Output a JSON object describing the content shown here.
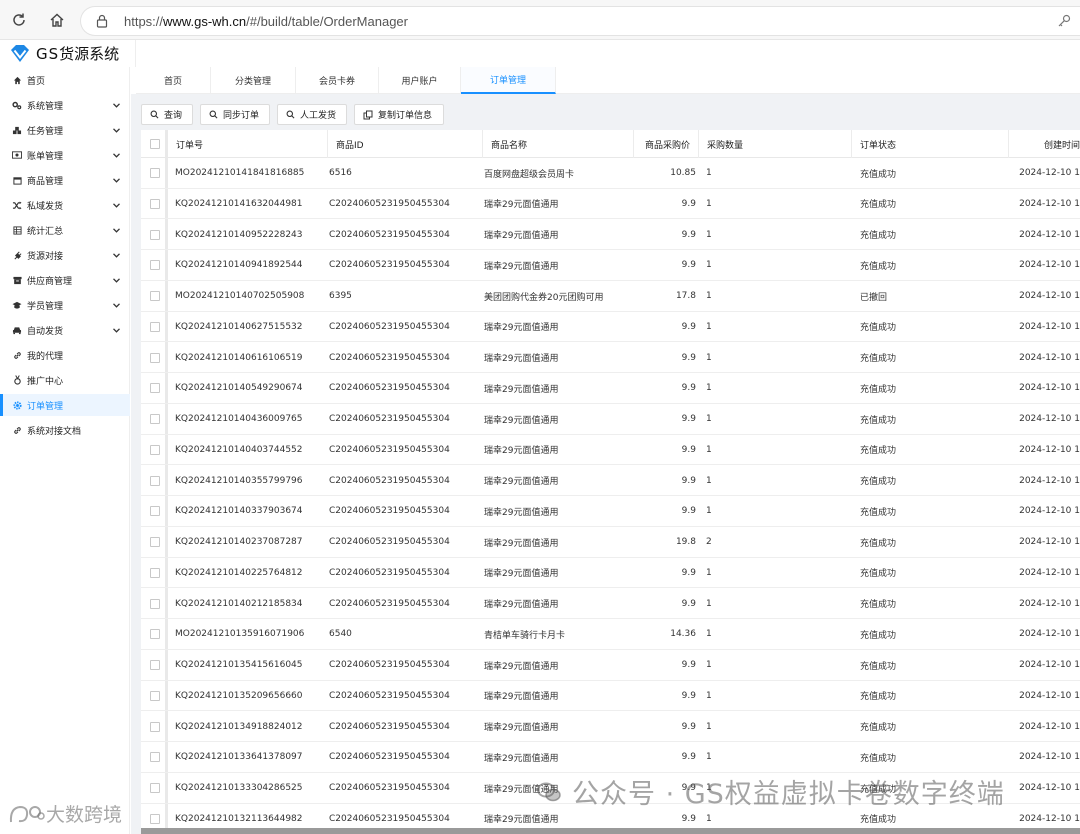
{
  "browser": {
    "url_prefix": "https://",
    "url_host": "www.gs-wh.cn",
    "url_path": "/#/build/table/OrderManager"
  },
  "app": {
    "logo_gs": "GS",
    "logo_name": "货源系统"
  },
  "sidebar": {
    "items": [
      {
        "label": "首页",
        "icon": "home-icon",
        "has_chevron": false
      },
      {
        "label": "系统管理",
        "icon": "gears-icon",
        "has_chevron": true
      },
      {
        "label": "任务管理",
        "icon": "cubes-icon",
        "has_chevron": true
      },
      {
        "label": "账单管理",
        "icon": "money-icon",
        "has_chevron": true
      },
      {
        "label": "商品管理",
        "icon": "calendar-icon",
        "has_chevron": true
      },
      {
        "label": "私域发货",
        "icon": "random-icon",
        "has_chevron": true
      },
      {
        "label": "统计汇总",
        "icon": "table-icon",
        "has_chevron": true
      },
      {
        "label": "货源对接",
        "icon": "plug-icon",
        "has_chevron": true
      },
      {
        "label": "供应商管理",
        "icon": "archive-icon",
        "has_chevron": true
      },
      {
        "label": "学员管理",
        "icon": "graduation-cap-icon",
        "has_chevron": true
      },
      {
        "label": "自动发货",
        "icon": "car-icon",
        "has_chevron": true
      },
      {
        "label": "我的代理",
        "icon": "link-icon",
        "has_chevron": false
      },
      {
        "label": "推广中心",
        "icon": "medal-icon",
        "has_chevron": false
      },
      {
        "label": "订单管理",
        "icon": "gear-icon",
        "has_chevron": false,
        "active": true
      },
      {
        "label": "系统对接文档",
        "icon": "link-icon",
        "has_chevron": false
      }
    ]
  },
  "tabs": [
    {
      "label": "首页"
    },
    {
      "label": "分类管理"
    },
    {
      "label": "会员卡券"
    },
    {
      "label": "用户账户"
    },
    {
      "label": "订单管理",
      "active": true
    }
  ],
  "toolbar": {
    "search": "查询",
    "sync": "同步订单",
    "manual": "人工发货",
    "copy": "复制订单信息"
  },
  "table": {
    "headers": {
      "order_no": "订单号",
      "product_id": "商品ID",
      "product_name": "商品名称",
      "price": "商品采购价",
      "qty": "采购数量",
      "status": "订单状态",
      "created": "创建时间"
    },
    "rows": [
      [
        "MO20241210141841816885",
        "6516",
        "百度网盘超级会员周卡",
        "10.85",
        "1",
        "充值成功",
        "2024-12-10 1"
      ],
      [
        "KQ20241210141632044981",
        "C20240605231950455304",
        "瑞幸29元面值通用",
        "9.9",
        "1",
        "充值成功",
        "2024-12-10 1"
      ],
      [
        "KQ20241210140952228243",
        "C20240605231950455304",
        "瑞幸29元面值通用",
        "9.9",
        "1",
        "充值成功",
        "2024-12-10 1"
      ],
      [
        "KQ20241210140941892544",
        "C20240605231950455304",
        "瑞幸29元面值通用",
        "9.9",
        "1",
        "充值成功",
        "2024-12-10 1"
      ],
      [
        "MO20241210140702505908",
        "6395",
        "美团团购代金券20元团购可用",
        "17.8",
        "1",
        "已撤回",
        "2024-12-10 1"
      ],
      [
        "KQ20241210140627515532",
        "C20240605231950455304",
        "瑞幸29元面值通用",
        "9.9",
        "1",
        "充值成功",
        "2024-12-10 1"
      ],
      [
        "KQ20241210140616106519",
        "C20240605231950455304",
        "瑞幸29元面值通用",
        "9.9",
        "1",
        "充值成功",
        "2024-12-10 1"
      ],
      [
        "KQ20241210140549290674",
        "C20240605231950455304",
        "瑞幸29元面值通用",
        "9.9",
        "1",
        "充值成功",
        "2024-12-10 1"
      ],
      [
        "KQ20241210140436009765",
        "C20240605231950455304",
        "瑞幸29元面值通用",
        "9.9",
        "1",
        "充值成功",
        "2024-12-10 1"
      ],
      [
        "KQ20241210140403744552",
        "C20240605231950455304",
        "瑞幸29元面值通用",
        "9.9",
        "1",
        "充值成功",
        "2024-12-10 1"
      ],
      [
        "KQ20241210140355799796",
        "C20240605231950455304",
        "瑞幸29元面值通用",
        "9.9",
        "1",
        "充值成功",
        "2024-12-10 1"
      ],
      [
        "KQ20241210140337903674",
        "C20240605231950455304",
        "瑞幸29元面值通用",
        "9.9",
        "1",
        "充值成功",
        "2024-12-10 1"
      ],
      [
        "KQ20241210140237087287",
        "C20240605231950455304",
        "瑞幸29元面值通用",
        "19.8",
        "2",
        "充值成功",
        "2024-12-10 1"
      ],
      [
        "KQ20241210140225764812",
        "C20240605231950455304",
        "瑞幸29元面值通用",
        "9.9",
        "1",
        "充值成功",
        "2024-12-10 1"
      ],
      [
        "KQ20241210140212185834",
        "C20240605231950455304",
        "瑞幸29元面值通用",
        "9.9",
        "1",
        "充值成功",
        "2024-12-10 1"
      ],
      [
        "MO20241210135916071906",
        "6540",
        "青桔单车骑行卡月卡",
        "14.36",
        "1",
        "充值成功",
        "2024-12-10 1"
      ],
      [
        "KQ20241210135415616045",
        "C20240605231950455304",
        "瑞幸29元面值通用",
        "9.9",
        "1",
        "充值成功",
        "2024-12-10 1"
      ],
      [
        "KQ20241210135209656660",
        "C20240605231950455304",
        "瑞幸29元面值通用",
        "9.9",
        "1",
        "充值成功",
        "2024-12-10 1"
      ],
      [
        "KQ20241210134918824012",
        "C20240605231950455304",
        "瑞幸29元面值通用",
        "9.9",
        "1",
        "充值成功",
        "2024-12-10 1"
      ],
      [
        "KQ20241210133641378097",
        "C20240605231950455304",
        "瑞幸29元面值通用",
        "9.9",
        "1",
        "充值成功",
        "2024-12-10 1"
      ],
      [
        "KQ20241210133304286525",
        "C20240605231950455304",
        "瑞幸29元面值通用",
        "9.9",
        "1",
        "充值成功",
        "2024-12-10 1"
      ],
      [
        "KQ20241210132113644982",
        "C20240605231950455304",
        "瑞幸29元面值通用",
        "9.9",
        "1",
        "充值成功",
        "2024-12-10 1"
      ]
    ]
  },
  "watermark": {
    "text": "公众号 · GS权益虚拟卡卷数字终端",
    "text2": "大数跨境"
  },
  "colors": {
    "accent": "#1890ff",
    "logo": "#1e88e5"
  }
}
